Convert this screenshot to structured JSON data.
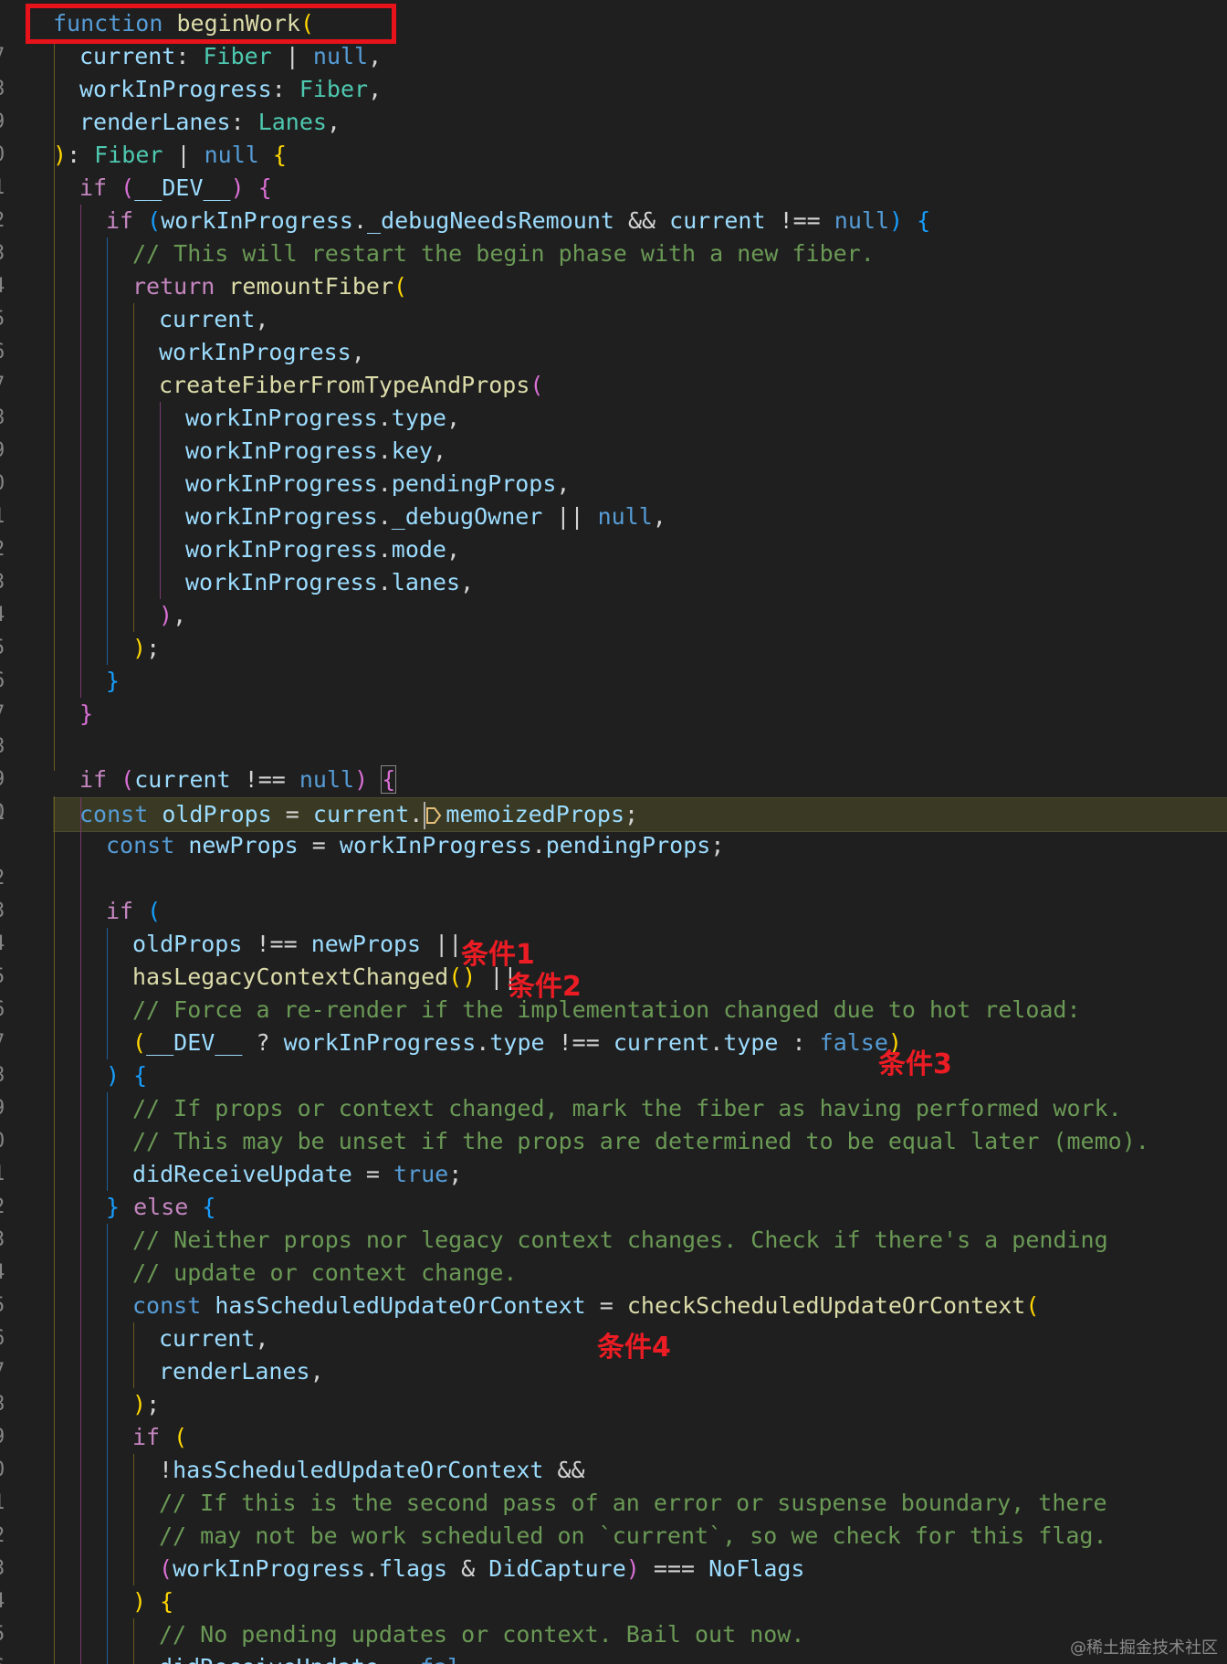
{
  "gutter": {
    "line_numbers": [
      "7",
      "8",
      "9",
      "0",
      "1",
      "2",
      "3",
      "4",
      "5",
      "6",
      "7",
      "8",
      "9",
      "0",
      "1",
      "2",
      "3",
      "4",
      "5",
      "6",
      "7",
      "8",
      "9",
      "0",
      "1",
      "2",
      "3",
      "4",
      "5",
      "6",
      "7",
      "8",
      "9",
      "0",
      "1",
      "2",
      "3",
      "4",
      "5",
      "6",
      "7",
      "8",
      "9",
      "0",
      "1",
      "2",
      "3",
      "4",
      "5",
      "6",
      "7"
    ]
  },
  "code": {
    "l1": {
      "kw": "function",
      "fn": "beginWork",
      "b": "("
    },
    "l2": {
      "var": "current",
      "sep": ": ",
      "type": "Fiber",
      "op": " | ",
      "kw": "null",
      "end": ","
    },
    "l3": {
      "var": "workInProgress",
      "sep": ": ",
      "type": "Fiber",
      "end": ","
    },
    "l4": {
      "var": "renderLanes",
      "sep": ": ",
      "type": "Lanes",
      "end": ","
    },
    "l5": {
      "b": ")",
      "sep": ": ",
      "type": "Fiber",
      "op": " | ",
      "kw": "null",
      "b2": "{"
    },
    "l6": {
      "ctrl": "if",
      "b": "(",
      "var": "__DEV__",
      "b_close": ")",
      "b2": "{"
    },
    "l7": {
      "ctrl": "if",
      "b": "(",
      "var": "workInProgress",
      "dot": ".",
      "prop": "_debugNeedsRemount",
      "op": " && ",
      "var2": "current",
      "op2": " !== ",
      "kw": "null",
      "b_close": ")",
      "b2": "{"
    },
    "l8": {
      "cm": "// This will restart the begin phase with a new fiber."
    },
    "l9": {
      "ctrl": "return",
      "fn": "remountFiber",
      "b": "("
    },
    "l10": {
      "var": "current",
      "end": ","
    },
    "l11": {
      "var": "workInProgress",
      "end": ","
    },
    "l12": {
      "fn": "createFiberFromTypeAndProps",
      "b": "("
    },
    "l13": {
      "var": "workInProgress",
      "dot": ".",
      "prop": "type",
      "end": ","
    },
    "l14": {
      "var": "workInProgress",
      "dot": ".",
      "prop": "key",
      "end": ","
    },
    "l15": {
      "var": "workInProgress",
      "dot": ".",
      "prop": "pendingProps",
      "end": ","
    },
    "l16": {
      "var": "workInProgress",
      "dot": ".",
      "prop": "_debugOwner",
      "op": " || ",
      "kw": "null",
      "end": ","
    },
    "l17": {
      "var": "workInProgress",
      "dot": ".",
      "prop": "mode",
      "end": ","
    },
    "l18": {
      "var": "workInProgress",
      "dot": ".",
      "prop": "lanes",
      "end": ","
    },
    "l19": {
      "b": ")",
      "end": ","
    },
    "l20": {
      "b": ")",
      "end": ";"
    },
    "l21": {
      "b": "}"
    },
    "l22": {
      "b": "}"
    },
    "l23": {},
    "l24": {
      "ctrl": "if",
      "b": "(",
      "var": "current",
      "op": " !== ",
      "kw": "null",
      "b_close": ")",
      "b2": "{"
    },
    "l25": {
      "kw": "const",
      "var": "oldProps",
      "op": " = ",
      "var2": "current",
      "dot": ".",
      "prop": "memoizedProps",
      "end": ";"
    },
    "l26": {
      "kw": "const",
      "var": "newProps",
      "op": " = ",
      "var2": "workInProgress",
      "dot": ".",
      "prop": "pendingProps",
      "end": ";"
    },
    "l27": {},
    "l28": {
      "ctrl": "if",
      "b": "("
    },
    "l29": {
      "var": "oldProps",
      "op": " !== ",
      "var2": "newProps",
      "op2": " ||"
    },
    "l30": {
      "fn": "hasLegacyContextChanged",
      "b": "()",
      "op": " ||"
    },
    "l31": {
      "cm": "// Force a re-render if the implementation changed due to hot reload:"
    },
    "l32": {
      "b": "(",
      "var": "__DEV__",
      "op": " ? ",
      "var2": "workInProgress",
      "dot": ".",
      "prop": "type",
      "op2": " !== ",
      "var3": "current",
      "dot2": ".",
      "prop2": "type",
      "op3": " : ",
      "kw": "false",
      "b_close": ")"
    },
    "l33": {
      "b": ")",
      "b2": "{"
    },
    "l34": {
      "cm": "// If props or context changed, mark the fiber as having performed work."
    },
    "l35": {
      "cm": "// This may be unset if the props are determined to be equal later (memo)."
    },
    "l36": {
      "var": "didReceiveUpdate",
      "op": " = ",
      "kw": "true",
      "end": ";"
    },
    "l37": {
      "b": "}",
      "ctrl": "else",
      "b2": "{"
    },
    "l38": {
      "cm": "// Neither props nor legacy context changes. Check if there's a pending"
    },
    "l39": {
      "cm": "// update or context change."
    },
    "l40": {
      "kw": "const",
      "var": "hasScheduledUpdateOrContext",
      "op": " = ",
      "fn": "checkScheduledUpdateOrContext",
      "b": "("
    },
    "l41": {
      "var": "current",
      "end": ","
    },
    "l42": {
      "var": "renderLanes",
      "end": ","
    },
    "l43": {
      "b": ")",
      "end": ";"
    },
    "l44": {
      "ctrl": "if",
      "b": "("
    },
    "l45": {
      "op": "!",
      "var": "hasScheduledUpdateOrContext",
      "op2": " &&"
    },
    "l46": {
      "cm": "// If this is the second pass of an error or suspense boundary, there"
    },
    "l47": {
      "cm": "// may not be work scheduled on `current`, so we check for this flag."
    },
    "l48": {
      "b": "(",
      "var": "workInProgress",
      "dot": ".",
      "prop": "flags",
      "op": " & ",
      "var2": "DidCapture",
      "b_close": ")",
      "op2": " === ",
      "var3": "NoFlags"
    },
    "l49": {
      "b": ")",
      "b2": "{"
    },
    "l50": {
      "cm": "// No pending updates or context. Bail out now."
    },
    "l51": {
      "var": "didReceiveUpdate",
      "op": " = ",
      "kw": "fal"
    }
  },
  "annotations": {
    "cond1": "条件1",
    "cond2": "条件2",
    "cond3": "条件3",
    "cond4": "条件4"
  },
  "watermark": "@稀土掘金技术社区",
  "colors": {
    "background": "#1f1f1f",
    "annotation_red": "#ec1c24",
    "highlight_box": "#e8121a"
  }
}
